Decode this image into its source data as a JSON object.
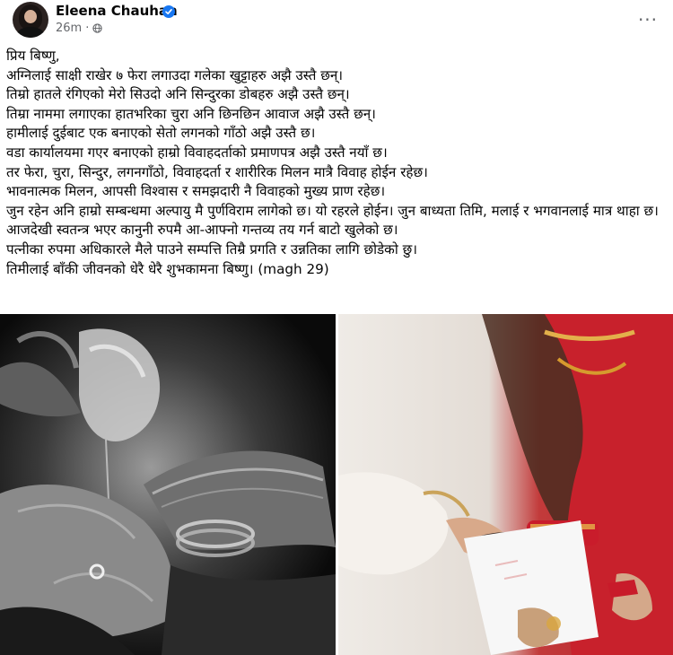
{
  "post": {
    "author": "Eleena Chauhan",
    "time": "26m",
    "separator": "·",
    "more_label": "···",
    "icons": {
      "verified": "verified-badge-icon",
      "audience": "globe-icon",
      "more": "more-options-icon"
    },
    "lines": [
      "प्रिय बिष्णु,",
      "अग्निलाई साक्षी राखेर ७ फेरा लगाउदा गलेका खुट्टाहरु अझै उस्तै छन्।",
      "तिम्रो हातले रंगिएको मेरो सिउदो अनि सिन्दुरका डोबहरु अझै उस्तै छन्।",
      "तिम्रा नाममा लगाएका हातभरिका चुरा अनि छिनछिन आवाज अझै उस्तै छन्।",
      "हामीलाई दुईबाट एक बनाएको सेतो लगनको गाँठो अझै उस्तै छ।",
      "वडा कार्यालयमा गएर बनाएको हाम्रो विवाहदर्ताको प्रमाणपत्र अझै उस्तै नयाँ छ।",
      "तर फेरा, चुरा, सिन्दुर, लगनगाँठो, विवाहदर्ता र शारीरिक मिलन मात्रै विवाह होईन रहेछ।",
      "भावनात्मक मिलन, आपसी विश्वास र समझदारी नै विवाहको मुख्य प्राण रहेछ।",
      "जुन रहेन अनि हाम्रो सम्बन्धमा अल्पायु मै पुर्णविराम लागेको छ। यो रहरले होईन। जुन बाध्यता तिमि, मलाई र भगवानलाई मात्र थाहा छ।",
      "आजदेखी स्वतन्त्र भएर कानुनी रुपमै आ-आफ्नो गन्तव्य तय गर्न बाटो खुलेको छ।",
      "पत्नीका रुपमा अधिकारले मैले पाउने सम्पत्ति तिम्रै प्रगति र उन्नतिका लागि छोडेको छु।",
      "तिमीलाई बाँकी जीवनको धेरै धेरै शुभकामना बिष्णु। (magh 29)"
    ],
    "photos": [
      {
        "name": "wedding-ritual-bw-photo"
      },
      {
        "name": "wedding-sindoor-photo"
      }
    ],
    "colors": {
      "verified": "#1877f2",
      "secondary_text": "#65676b"
    }
  }
}
